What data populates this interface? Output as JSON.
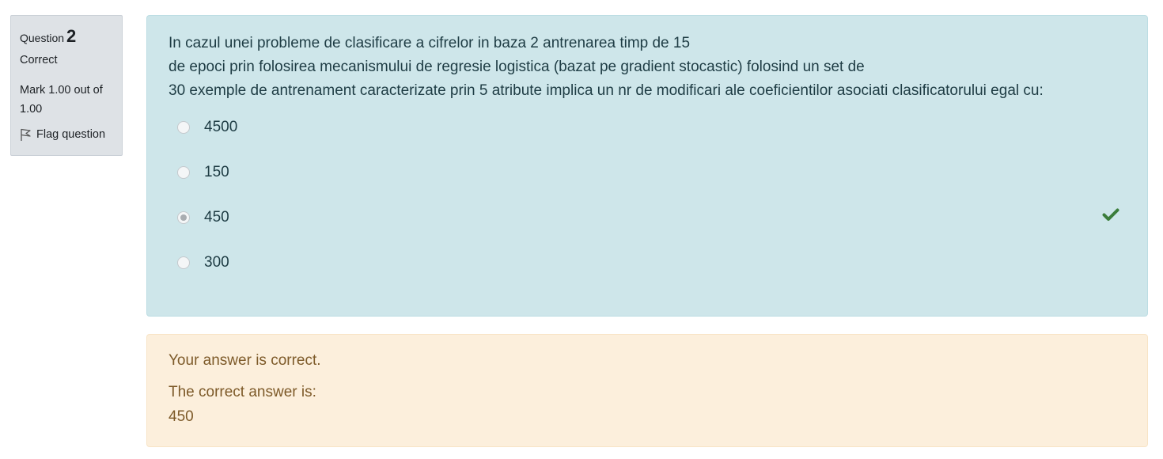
{
  "info": {
    "question_label": "Question",
    "question_number": "2",
    "state": "Correct",
    "grade": "Mark 1.00 out of 1.00",
    "flag_label": "Flag question"
  },
  "question": {
    "text_lines": [
      "In cazul unei probleme de clasificare a cifrelor in baza 2 antrenarea timp de 15",
      "de epoci prin folosirea mecanismului de regresie logistica (bazat pe gradient stocastic) folosind un set de",
      "30 exemple de antrenament caracterizate prin 5 atribute implica un nr de modificari ale coeficientilor asociati clasificatorului egal cu:"
    ],
    "answers": [
      {
        "label": "4500",
        "selected": false
      },
      {
        "label": "150",
        "selected": false
      },
      {
        "label": "450",
        "selected": true,
        "correct_mark": "check-icon"
      },
      {
        "label": "300",
        "selected": false
      }
    ]
  },
  "feedback": {
    "status": "Your answer is correct.",
    "correct_answer_label": "The correct answer is:",
    "correct_answer_value": "450"
  },
  "colors": {
    "formulation_bg": "#cee6ea",
    "feedback_bg": "#fcefdc",
    "info_bg": "#dee2e6",
    "check_green": "#3b7d3b"
  }
}
